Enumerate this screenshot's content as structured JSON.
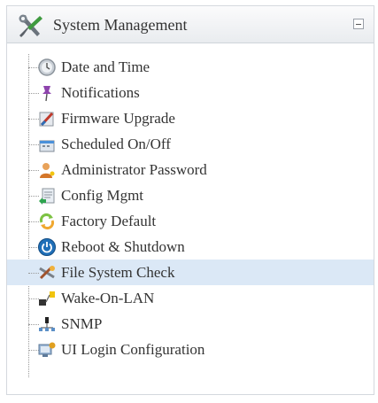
{
  "panel": {
    "title": "System Management",
    "header_icon": "tools-icon",
    "collapse_icon": "collapse-icon"
  },
  "menu": {
    "items": [
      {
        "label": "Date and Time",
        "icon": "clock-icon"
      },
      {
        "label": "Notifications",
        "icon": "pin-icon"
      },
      {
        "label": "Firmware Upgrade",
        "icon": "firmware-icon"
      },
      {
        "label": "Scheduled On/Off",
        "icon": "schedule-icon"
      },
      {
        "label": "Administrator Password",
        "icon": "user-key-icon"
      },
      {
        "label": "Config Mgmt",
        "icon": "config-icon"
      },
      {
        "label": "Factory Default",
        "icon": "refresh-icon"
      },
      {
        "label": "Reboot & Shutdown",
        "icon": "power-icon"
      },
      {
        "label": "File System Check",
        "icon": "filesystem-icon"
      },
      {
        "label": "Wake-On-LAN",
        "icon": "lan-icon"
      },
      {
        "label": "SNMP",
        "icon": "network-icon"
      },
      {
        "label": "UI Login Configuration",
        "icon": "login-config-icon"
      }
    ],
    "selected_index": 8
  }
}
